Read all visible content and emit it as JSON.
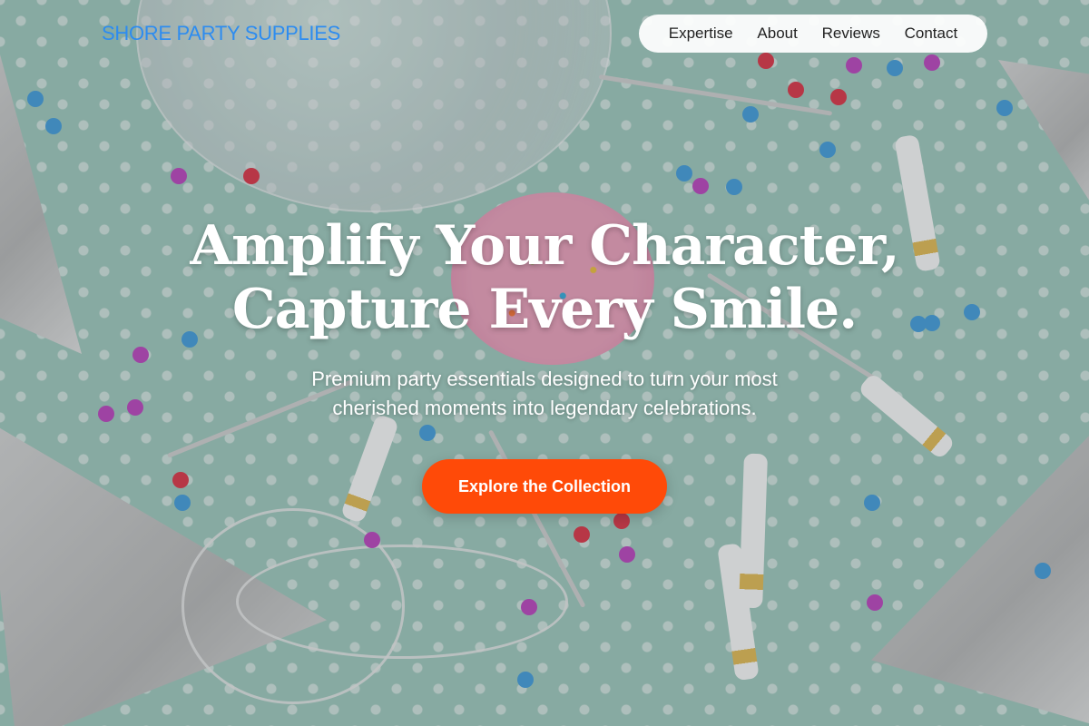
{
  "brand": {
    "name": "SHORE PARTY SUPPLIES",
    "color": "#2d8cf0"
  },
  "nav": {
    "items": [
      {
        "label": "Expertise"
      },
      {
        "label": "About"
      },
      {
        "label": "Reviews"
      },
      {
        "label": "Contact"
      }
    ]
  },
  "hero": {
    "title_line1": "Amplify Your Character,",
    "title_line2": "Capture Every Smile.",
    "subtitle_line1": "Premium party essentials designed to turn your most",
    "subtitle_line2": "cherished moments into legendary celebrations.",
    "cta_label": "Explore the Collection",
    "cta_color": "#ff4a08"
  }
}
